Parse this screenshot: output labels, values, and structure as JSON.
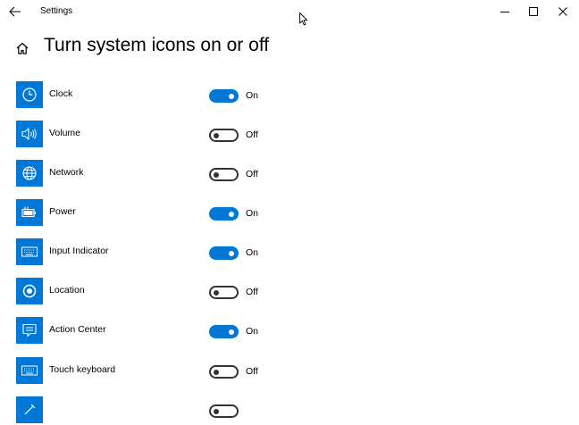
{
  "window": {
    "title": "Settings",
    "back_icon": "back-arrow-icon",
    "minimize_icon": "minimize-icon",
    "maximize_icon": "maximize-icon",
    "close_icon": "close-icon"
  },
  "page": {
    "title": "Turn system icons on or off",
    "home_icon": "home-icon"
  },
  "colors": {
    "accent": "#0078d7",
    "toggle_off_border": "#333333"
  },
  "items": [
    {
      "label": "Clock",
      "icon": "clock-icon",
      "on": true,
      "state": "On"
    },
    {
      "label": "Volume",
      "icon": "volume-icon",
      "on": false,
      "state": "Off"
    },
    {
      "label": "Network",
      "icon": "network-globe-icon",
      "on": false,
      "state": "Off"
    },
    {
      "label": "Power",
      "icon": "battery-icon",
      "on": true,
      "state": "On"
    },
    {
      "label": "Input Indicator",
      "icon": "keyboard-icon",
      "on": true,
      "state": "On"
    },
    {
      "label": "Location",
      "icon": "location-icon",
      "on": false,
      "state": "Off"
    },
    {
      "label": "Action Center",
      "icon": "action-center-icon",
      "on": true,
      "state": "On"
    },
    {
      "label": "Touch keyboard",
      "icon": "touch-keyboard-icon",
      "on": false,
      "state": "Off"
    },
    {
      "label": "",
      "icon": "pen-icon",
      "on": false,
      "state": ""
    }
  ]
}
